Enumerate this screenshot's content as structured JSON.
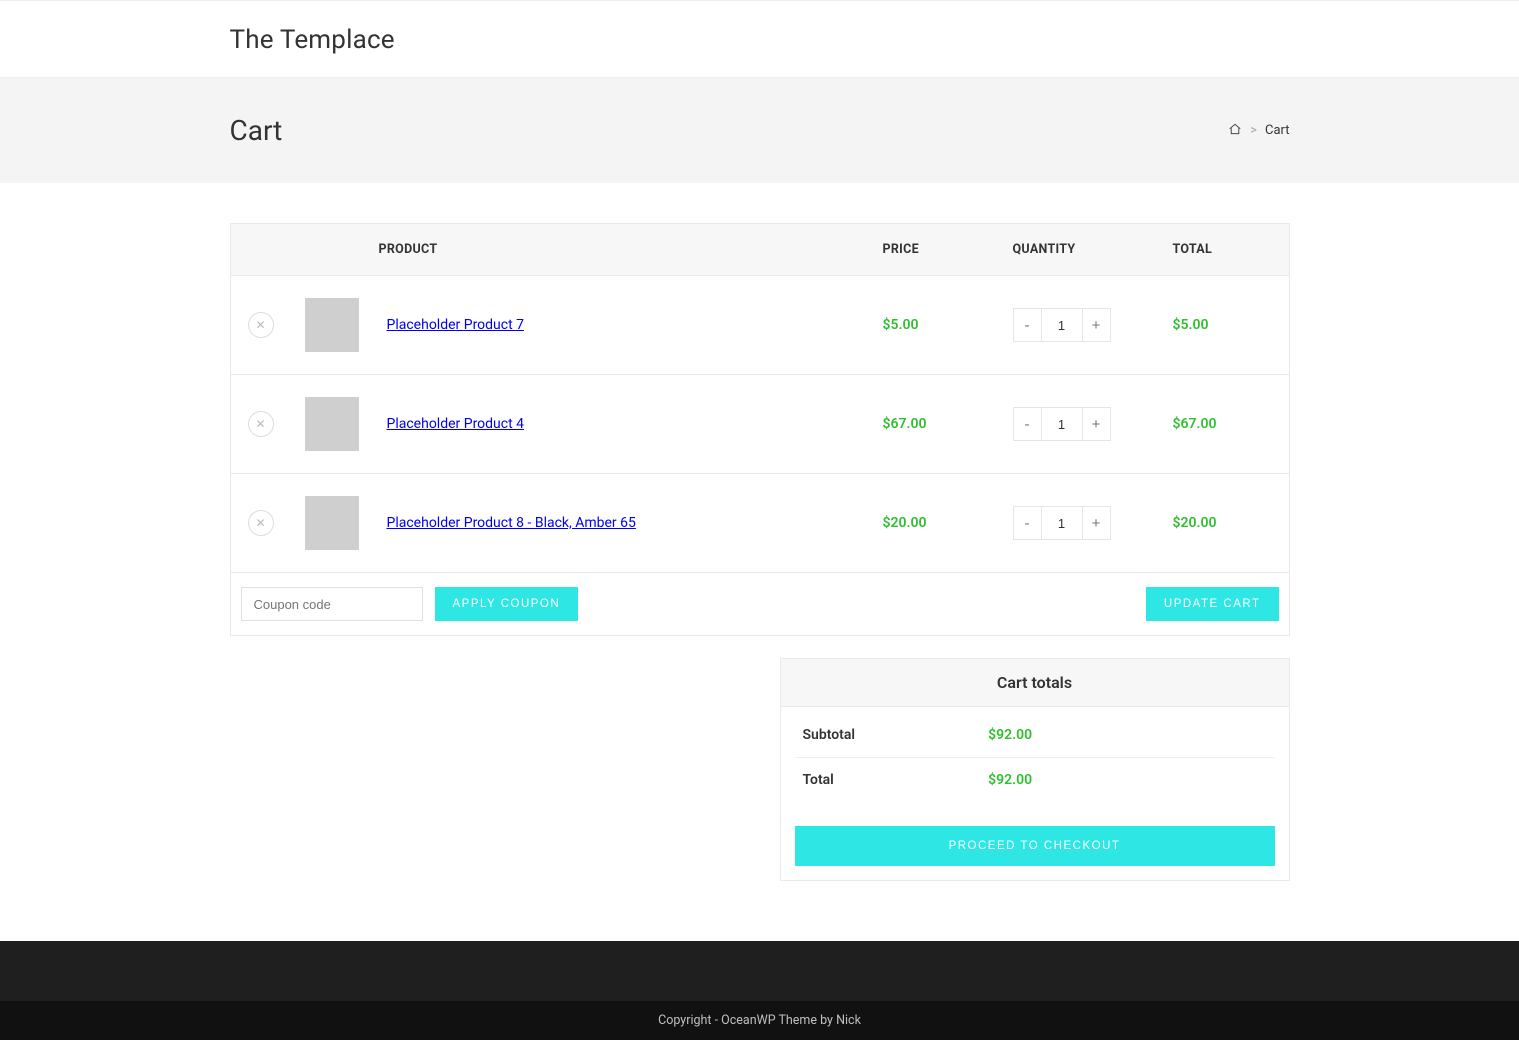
{
  "site": {
    "title": "The Templace"
  },
  "page": {
    "title": "Cart",
    "breadcrumb_current": "Cart"
  },
  "table": {
    "headers": {
      "product": "PRODUCT",
      "price": "PRICE",
      "quantity": "QUANTITY",
      "total": "TOTAL"
    },
    "rows": [
      {
        "name": "Placeholder Product 7",
        "price": "$5.00",
        "qty": "1",
        "total": "$5.00"
      },
      {
        "name": "Placeholder Product 4",
        "price": "$67.00",
        "qty": "1",
        "total": "$67.00"
      },
      {
        "name": "Placeholder Product 8 - Black, Amber 65",
        "price": "$20.00",
        "qty": "1",
        "total": "$20.00"
      }
    ]
  },
  "coupon": {
    "placeholder": "Coupon code",
    "apply_label": "APPLY COUPON"
  },
  "update_cart_label": "UPDATE CART",
  "cart_totals": {
    "heading": "Cart totals",
    "subtotal_label": "Subtotal",
    "subtotal_value": "$92.00",
    "total_label": "Total",
    "total_value": "$92.00",
    "checkout_label": "PROCEED TO CHECKOUT"
  },
  "footer": {
    "copyright": "Copyright - OceanWP Theme by Nick"
  },
  "colors": {
    "accent": "#2ee6e3",
    "price_green": "#2fbf2f"
  }
}
